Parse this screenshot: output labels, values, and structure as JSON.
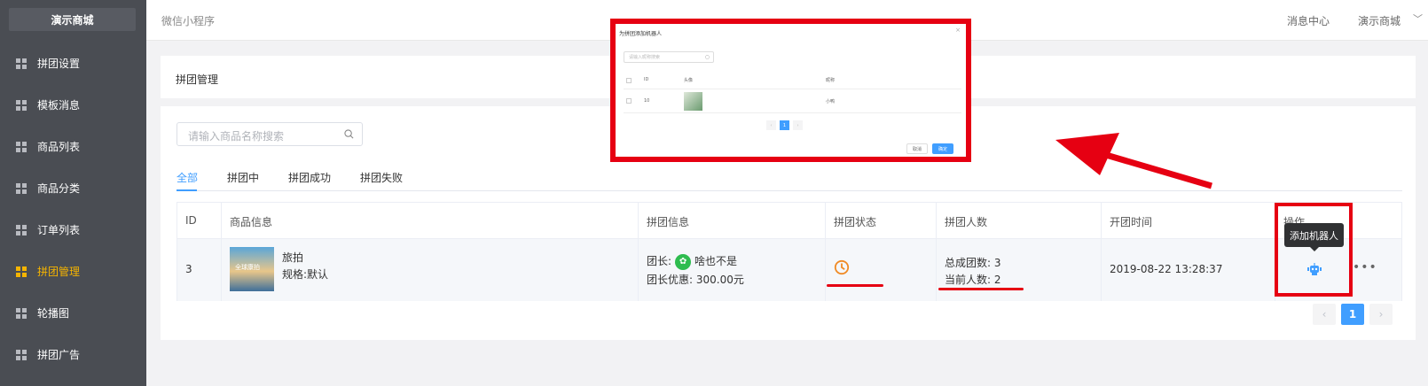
{
  "sidebar": {
    "brand": "演示商城",
    "items": [
      {
        "label": "拼团设置",
        "active": false
      },
      {
        "label": "模板消息",
        "active": false
      },
      {
        "label": "商品列表",
        "active": false
      },
      {
        "label": "商品分类",
        "active": false
      },
      {
        "label": "订单列表",
        "active": false
      },
      {
        "label": "拼团管理",
        "active": true
      },
      {
        "label": "轮播图",
        "active": false
      },
      {
        "label": "拼团广告",
        "active": false
      }
    ]
  },
  "topbar": {
    "title": "微信小程序",
    "messages": "消息中心",
    "store": "演示商城",
    "chevron": "﹀"
  },
  "page": {
    "title": "拼团管理",
    "search_placeholder": "请输入商品名称搜索",
    "tabs": [
      "全部",
      "拼团中",
      "拼团成功",
      "拼团失败"
    ],
    "active_tab": 0
  },
  "table": {
    "headers": [
      "ID",
      "商品信息",
      "拼团信息",
      "拼团状态",
      "拼团人数",
      "开团时间",
      "操作"
    ],
    "row": {
      "id": "3",
      "product_name": "旅拍",
      "product_spec": "规格:默认",
      "thumb_text": "全球康拍",
      "leader_label": "团长:",
      "leader_name": "啥也不是",
      "leader_discount": "团长优惠: 300.00元",
      "total_groups": "总成团数:  3",
      "current_people": "当前人数:  2",
      "open_time": "2019-08-22 13:28:37",
      "more": "•••"
    }
  },
  "tooltip": "添加机器人",
  "pagination": {
    "prev": "‹",
    "current": "1",
    "next": "›"
  },
  "modal": {
    "title": "为拼团添加机器人",
    "close": "×",
    "search_placeholder": "请输入昵称搜索",
    "search_icon": "○",
    "headers": {
      "id": "ID",
      "avatar": "头像",
      "nickname": "昵称"
    },
    "row": {
      "id": "10",
      "nickname": "小鸭"
    },
    "pager": {
      "prev": "‹",
      "current": "1",
      "next": "›"
    },
    "cancel": "取消",
    "confirm": "确定"
  },
  "colors": {
    "sidebar_bg": "#4a4d53",
    "active": "#f5b400",
    "primary": "#409eff",
    "annotation_red": "#e60012",
    "wechat": "#2ebc4f"
  }
}
